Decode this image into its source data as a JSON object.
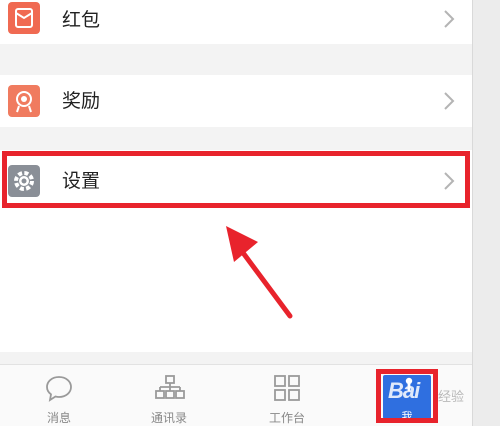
{
  "menu": {
    "items": [
      {
        "label": "红包",
        "icon": "red-envelope-icon"
      },
      {
        "label": "奖励",
        "icon": "award-icon"
      },
      {
        "label": "设置",
        "icon": "gear-icon"
      }
    ]
  },
  "tabbar": {
    "tabs": [
      {
        "label": "消息",
        "icon": "chat-bubble-icon"
      },
      {
        "label": "通讯录",
        "icon": "org-chart-icon"
      },
      {
        "label": "工作台",
        "icon": "grid-icon"
      },
      {
        "label": "我",
        "icon": "profile-icon"
      }
    ]
  },
  "colors": {
    "highlight": "#e8232c",
    "accent": "#2f6fe0",
    "red_envelope": "#f06a52",
    "award": "#f07b5f",
    "gear": "#8a8f97"
  }
}
